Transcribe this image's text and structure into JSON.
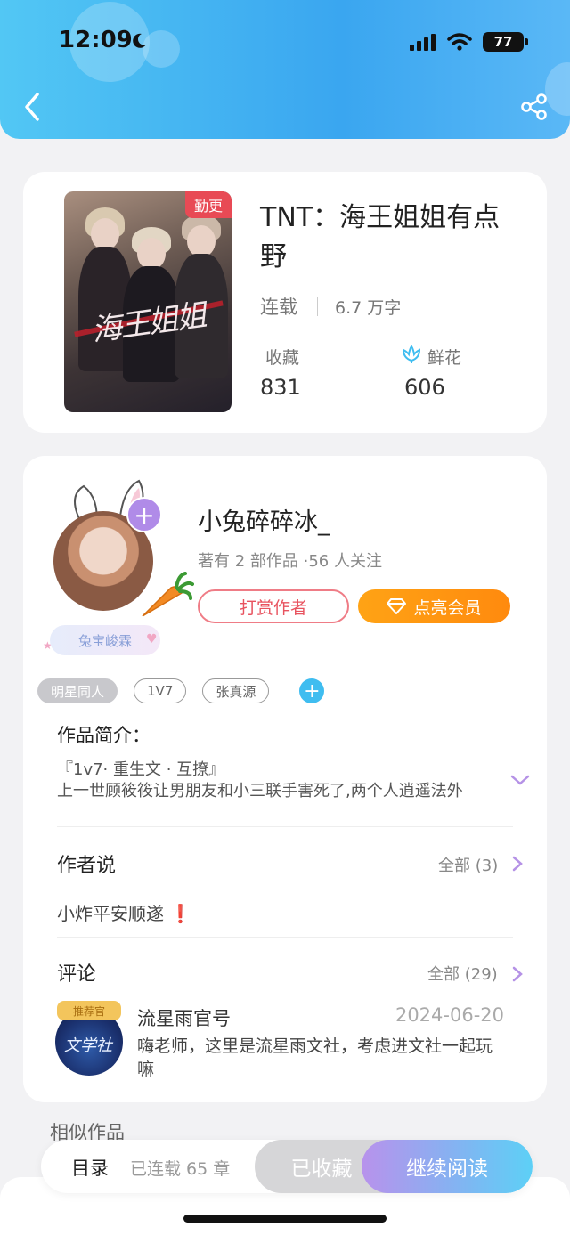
{
  "status": {
    "time": "12:09",
    "battery": "77"
  },
  "book": {
    "badge": "勤更",
    "title": "TNT：海王姐姐有点野",
    "status": "连载",
    "words": "6.7 万字",
    "favorites_label": "收藏",
    "favorites_value": "831",
    "flowers_label": "鲜花",
    "flowers_value": "606"
  },
  "author": {
    "name": "小兔碎碎冰_",
    "meta": "著有 2 部作品 ·56 人关注",
    "fan_badge": "兔宝峻霖",
    "tip_label": "打赏作者",
    "vip_label": "点亮会员"
  },
  "tags": [
    "明星同人",
    "1V7",
    "张真源"
  ],
  "intro": {
    "title": "作品简介：",
    "line1": "『1v7· 重生文 · 互撩』",
    "line2": "上一世顾筱筱让男朋友和小三联手害死了,两个人逍遥法外"
  },
  "author_says": {
    "title": "作者说",
    "more": "全部 (3)",
    "text": "小炸平安顺遂",
    "mark": "❗"
  },
  "comments": {
    "title": "评论",
    "more": "全部 (29)",
    "items": [
      {
        "name": "流星雨官号",
        "date": "2024-06-20",
        "text": "嗨老师，这里是流星雨文社，考虑进文社一起玩嘛",
        "badge": "推荐官"
      }
    ]
  },
  "similar_title": "相似作品",
  "bottom": {
    "toc": "目录",
    "chapters": "已连载 65 章",
    "favorited": "已收藏",
    "continue": "继续阅读"
  },
  "colors": {
    "accent": "#3aa6f0",
    "vip": "#ff9812",
    "tip": "#e8535f"
  },
  "icons": [
    "back-icon",
    "share-icon",
    "flower-icon",
    "diamond-icon",
    "expand-icon",
    "chevron-right-icon"
  ]
}
